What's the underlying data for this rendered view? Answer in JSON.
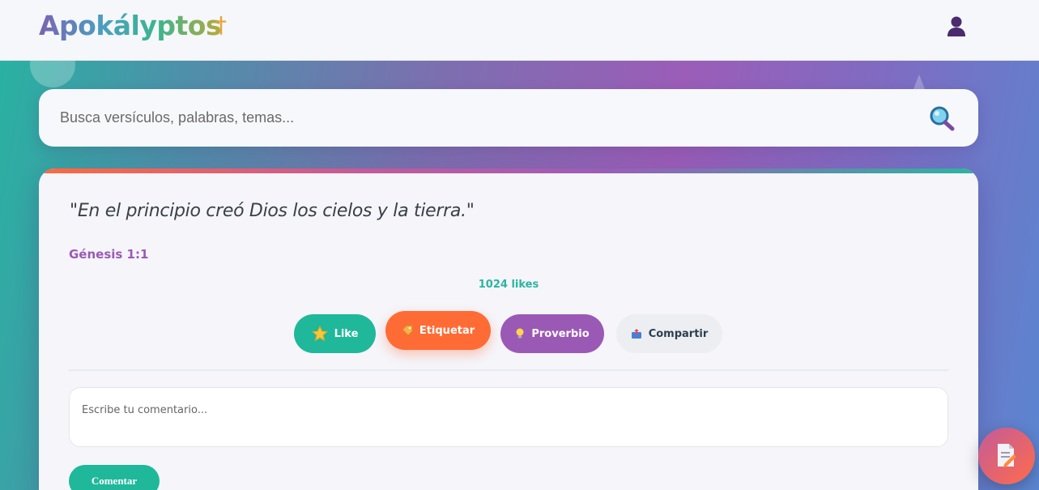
{
  "app": {
    "logo_text": "Apokályptos",
    "logo_symbol": "†"
  },
  "header": {
    "user_icon": "user-icon"
  },
  "search": {
    "placeholder": "Busca versículos, palabras, temas...",
    "value": "",
    "icon": "search-icon"
  },
  "verse_card": {
    "text": "\"En el principio creó Dios los cielos y la tierra.\"",
    "reference": "Génesis 1:1",
    "likes": "1024 likes",
    "actions": [
      {
        "label": "Like",
        "icon": "star-icon",
        "color": "#1fb89a"
      },
      {
        "label": "Etiquetar",
        "icon": "tag-icon",
        "color": "#ff6b35"
      },
      {
        "label": "Proverbio",
        "icon": "lightbulb-icon",
        "color": "#9b59b6"
      },
      {
        "label": "Compartir",
        "icon": "share-icon",
        "color": "#eceef1"
      }
    ],
    "comment_placeholder": "Escribe tu comentario...",
    "comment_value": "",
    "comment_button": "Comentar"
  },
  "fab": {
    "icon": "edit-document-icon"
  },
  "colors": {
    "accent_teal": "#1fb89a",
    "accent_orange": "#ff6b35",
    "accent_purple": "#9b59b6"
  }
}
